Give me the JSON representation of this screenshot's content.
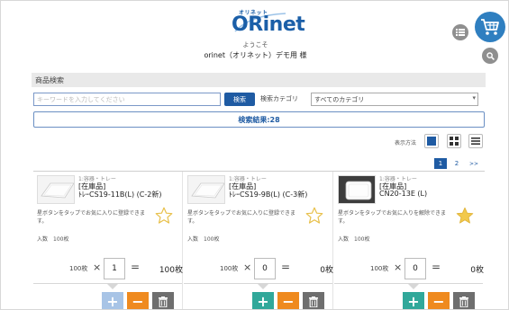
{
  "header": {
    "logo_small": "オリネット",
    "logo_big": "ORinet",
    "welcome": "ようこそ",
    "subtitle": "orinet（オリネット）デモ用 様"
  },
  "search": {
    "section_title": "商品検索",
    "placeholder": "キーワードを入力してください",
    "button_label": "検索",
    "category_label": "検索カテゴリ",
    "category_selected": "すべてのカテゴリ",
    "result_text": "検索結果:28"
  },
  "view": {
    "label": "表示方法"
  },
  "pagination": {
    "pages": [
      "1",
      "2"
    ],
    "next": ">>",
    "current": "1"
  },
  "products": [
    {
      "category": "1:容器・トレー",
      "stock_tag": "[在庫品]",
      "name": "ﾄﾚｰCS19-11B(L) (C-2新)",
      "note": "星ボタンをタップでお気に入りに登録できます。",
      "per_unit": "入数　100枚",
      "unit_label": "100枚",
      "quantity": "1",
      "total": "100枚",
      "favorite": false,
      "thumb": "light"
    },
    {
      "category": "1:容器・トレー",
      "stock_tag": "[在庫品]",
      "name": "ﾄﾚｰCS19-9B(L) (C-3新)",
      "note": "星ボタンをタップでお気に入りに登録できます。",
      "per_unit": "入数　100枚",
      "unit_label": "100枚",
      "quantity": "0",
      "total": "0枚",
      "favorite": false,
      "thumb": "light"
    },
    {
      "category": "1:容器・トレー",
      "stock_tag": "[在庫品]",
      "name": "CN20-13E (L)",
      "note": "星ボタンをタップでお気に入りを解除できます。",
      "per_unit": "入数　100枚",
      "unit_label": "100枚",
      "quantity": "0",
      "total": "0枚",
      "favorite": true,
      "thumb": "dark"
    }
  ],
  "colors": {
    "brand": "#1f5ba3",
    "cart": "#2f7fc0",
    "plus": "#31a89a",
    "minus": "#ef8a1f",
    "trash": "#6e6e6e",
    "star_active": "#f2c94c"
  },
  "icons": {
    "cart": "cart-icon",
    "list": "list-icon",
    "search": "search-icon",
    "grid_large": "grid-large-icon",
    "grid_small": "grid-small-icon",
    "list_view": "list-view-icon",
    "star": "star-icon",
    "plus": "plus-icon",
    "minus": "minus-icon",
    "trash": "trash-icon"
  }
}
